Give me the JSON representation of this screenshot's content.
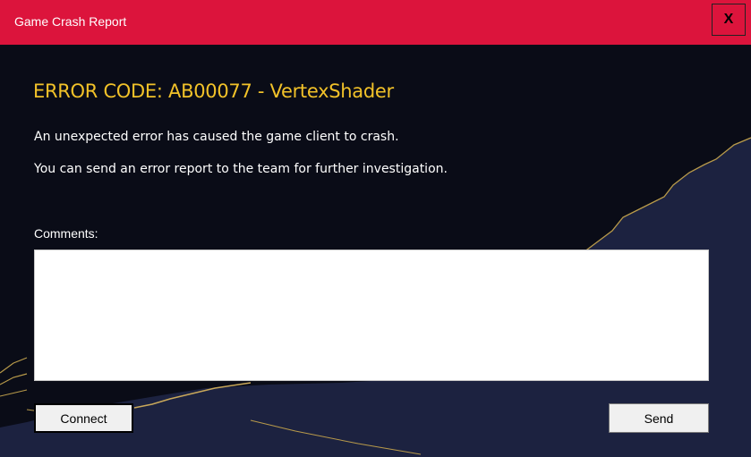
{
  "window": {
    "title": "Game Crash Report",
    "close_label": "X"
  },
  "content": {
    "error_heading": "ERROR CODE: AB00077 - VertexShader",
    "message_line1": "An unexpected error has caused the game client to crash.",
    "message_line2": "You can send an error report to the team for further investigation.",
    "comments_label": "Comments:",
    "comments_value": ""
  },
  "buttons": {
    "connect": "Connect",
    "send": "Send"
  },
  "colors": {
    "titlebar": "#dc143c",
    "background": "#0a0c17",
    "mountain": "#1c2240",
    "accent_gold": "#f2c229"
  }
}
